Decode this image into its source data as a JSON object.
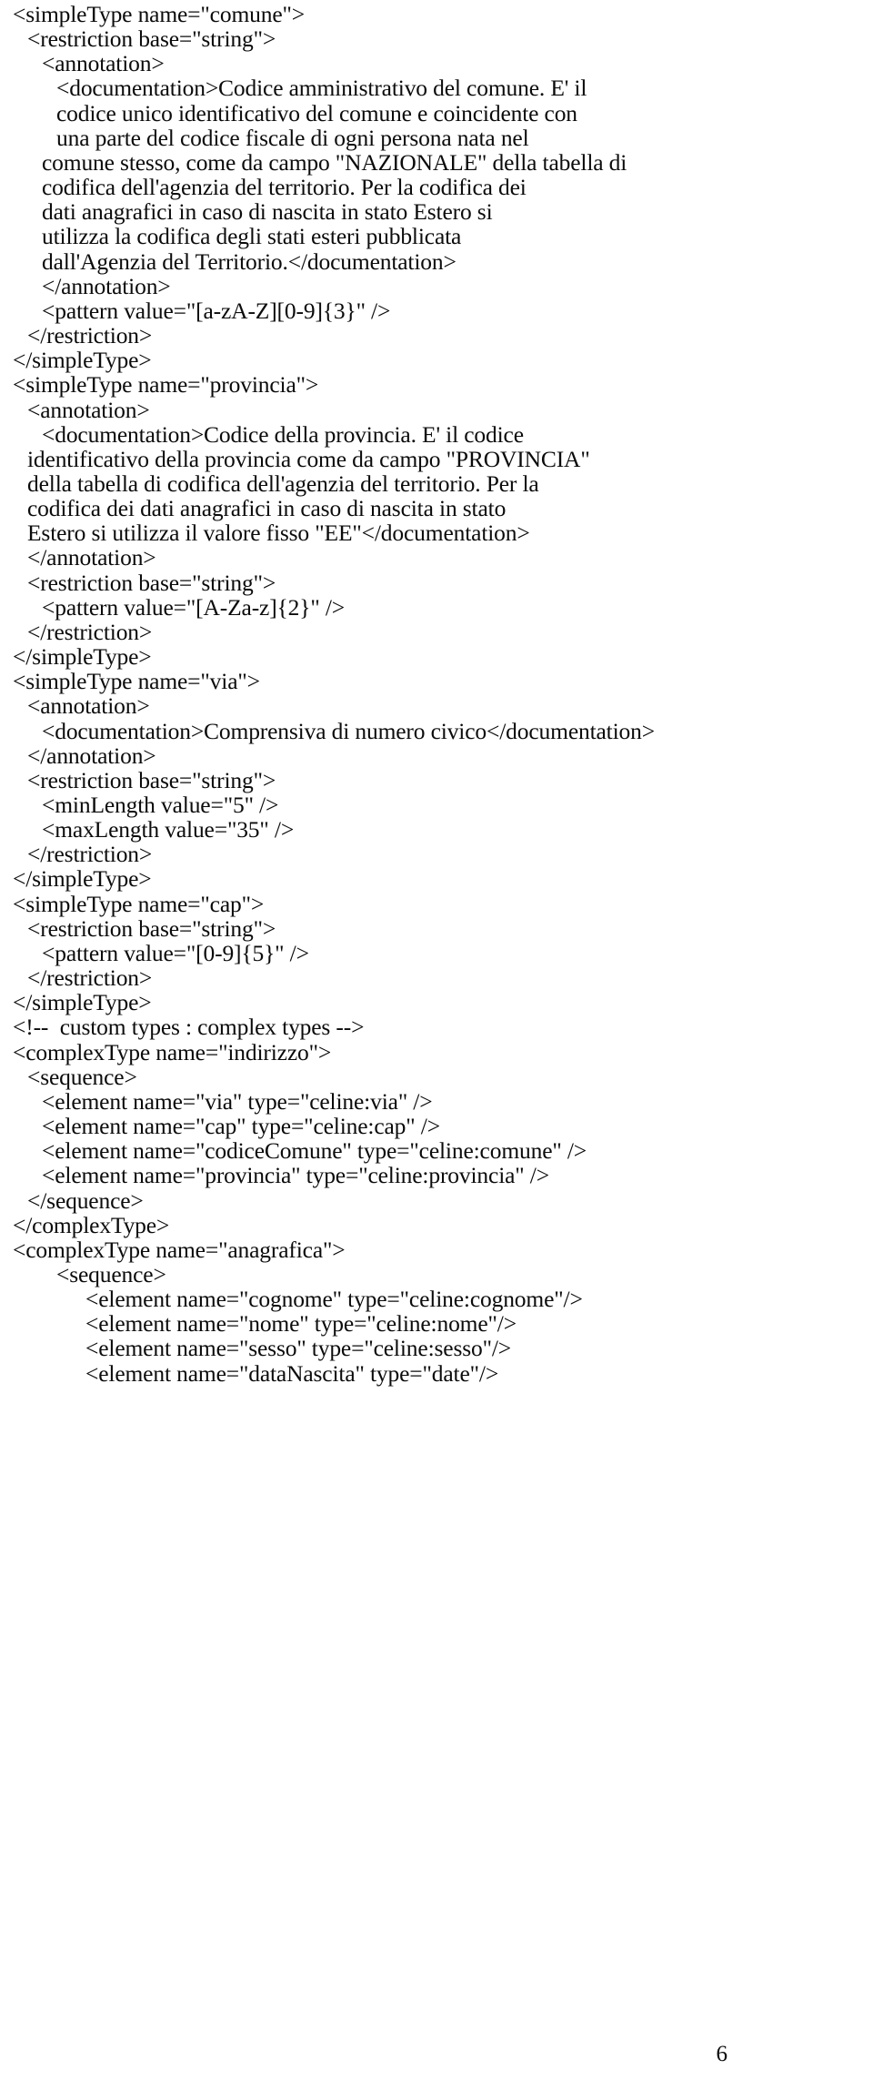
{
  "document": {
    "page_number": "6",
    "code_lines": [
      {
        "indent": 0,
        "text": "<simpleType name=\"comune\">"
      },
      {
        "indent": 1,
        "text": "<restriction base=\"string\">"
      },
      {
        "indent": 2,
        "text": "<annotation>"
      },
      {
        "indent": 3,
        "text": "<documentation>Codice amministrativo del comune. E' il"
      },
      {
        "indent": 3,
        "text": "codice unico identificativo del comune e coincidente con"
      },
      {
        "indent": 3,
        "text": "una parte del codice fiscale di ogni persona nata nel"
      },
      {
        "indent": 2,
        "text": "comune stesso, come da campo \"NAZIONALE\" della tabella di"
      },
      {
        "indent": 2,
        "text": "codifica dell'agenzia del territorio. Per la codifica dei"
      },
      {
        "indent": 2,
        "text": "dati anagrafici in caso di nascita in stato Estero si"
      },
      {
        "indent": 2,
        "text": "utilizza la codifica degli stati esteri pubblicata"
      },
      {
        "indent": 2,
        "text": "dall'Agenzia del Territorio.</documentation>"
      },
      {
        "indent": 2,
        "text": "</annotation>"
      },
      {
        "indent": 2,
        "text": "<pattern value=\"[a-zA-Z][0-9]{3}\" />"
      },
      {
        "indent": 1,
        "text": "</restriction>"
      },
      {
        "indent": 0,
        "text": "</simpleType>"
      },
      {
        "indent": 0,
        "text": "<simpleType name=\"provincia\">"
      },
      {
        "indent": 1,
        "text": "<annotation>"
      },
      {
        "indent": 2,
        "text": "<documentation>Codice della provincia. E' il codice"
      },
      {
        "indent": 1,
        "text": "identificativo della provincia come da campo \"PROVINCIA\""
      },
      {
        "indent": 1,
        "text": "della tabella di codifica dell'agenzia del territorio. Per la"
      },
      {
        "indent": 1,
        "text": "codifica dei dati anagrafici in caso di nascita in stato"
      },
      {
        "indent": 1,
        "text": "Estero si utilizza il valore fisso \"EE\"</documentation>"
      },
      {
        "indent": 1,
        "text": "</annotation>"
      },
      {
        "indent": 1,
        "text": "<restriction base=\"string\">"
      },
      {
        "indent": 2,
        "text": "<pattern value=\"[A-Za-z]{2}\" />"
      },
      {
        "indent": 1,
        "text": "</restriction>"
      },
      {
        "indent": 0,
        "text": "</simpleType>"
      },
      {
        "indent": 0,
        "text": "<simpleType name=\"via\">"
      },
      {
        "indent": 1,
        "text": "<annotation>"
      },
      {
        "indent": 2,
        "text": "<documentation>Comprensiva di numero civico</documentation>"
      },
      {
        "indent": 1,
        "text": "</annotation>"
      },
      {
        "indent": 1,
        "text": "<restriction base=\"string\">"
      },
      {
        "indent": 2,
        "text": "<minLength value=\"5\" />"
      },
      {
        "indent": 2,
        "text": "<maxLength value=\"35\" />"
      },
      {
        "indent": 1,
        "text": "</restriction>"
      },
      {
        "indent": 0,
        "text": "</simpleType>"
      },
      {
        "indent": 0,
        "text": "<simpleType name=\"cap\">"
      },
      {
        "indent": 1,
        "text": "<restriction base=\"string\">"
      },
      {
        "indent": 2,
        "text": "<pattern value=\"[0-9]{5}\" />"
      },
      {
        "indent": 1,
        "text": "</restriction>"
      },
      {
        "indent": 0,
        "text": "</simpleType>"
      },
      {
        "indent": 0,
        "text": "<!--  custom types : complex types -->"
      },
      {
        "indent": 0,
        "text": "<complexType name=\"indirizzo\">"
      },
      {
        "indent": 1,
        "text": "<sequence>"
      },
      {
        "indent": 2,
        "text": "<element name=\"via\" type=\"celine:via\" />"
      },
      {
        "indent": 2,
        "text": "<element name=\"cap\" type=\"celine:cap\" />"
      },
      {
        "indent": 2,
        "text": "<element name=\"codiceComune\" type=\"celine:comune\" />"
      },
      {
        "indent": 2,
        "text": "<element name=\"provincia\" type=\"celine:provincia\" />"
      },
      {
        "indent": 1,
        "text": "</sequence>"
      },
      {
        "indent": 0,
        "text": "</complexType>"
      },
      {
        "indent": 0,
        "text": "<complexType name=\"anagrafica\">"
      },
      {
        "indent": 3,
        "text": "<sequence>"
      },
      {
        "indent": 5,
        "text": "<element name=\"cognome\" type=\"celine:cognome\"/>"
      },
      {
        "indent": 5,
        "text": "<element name=\"nome\" type=\"celine:nome\"/>"
      },
      {
        "indent": 5,
        "text": "<element name=\"sesso\" type=\"celine:sesso\"/>"
      },
      {
        "indent": 5,
        "text": "<element name=\"dataNascita\" type=\"date\"/>"
      }
    ]
  }
}
